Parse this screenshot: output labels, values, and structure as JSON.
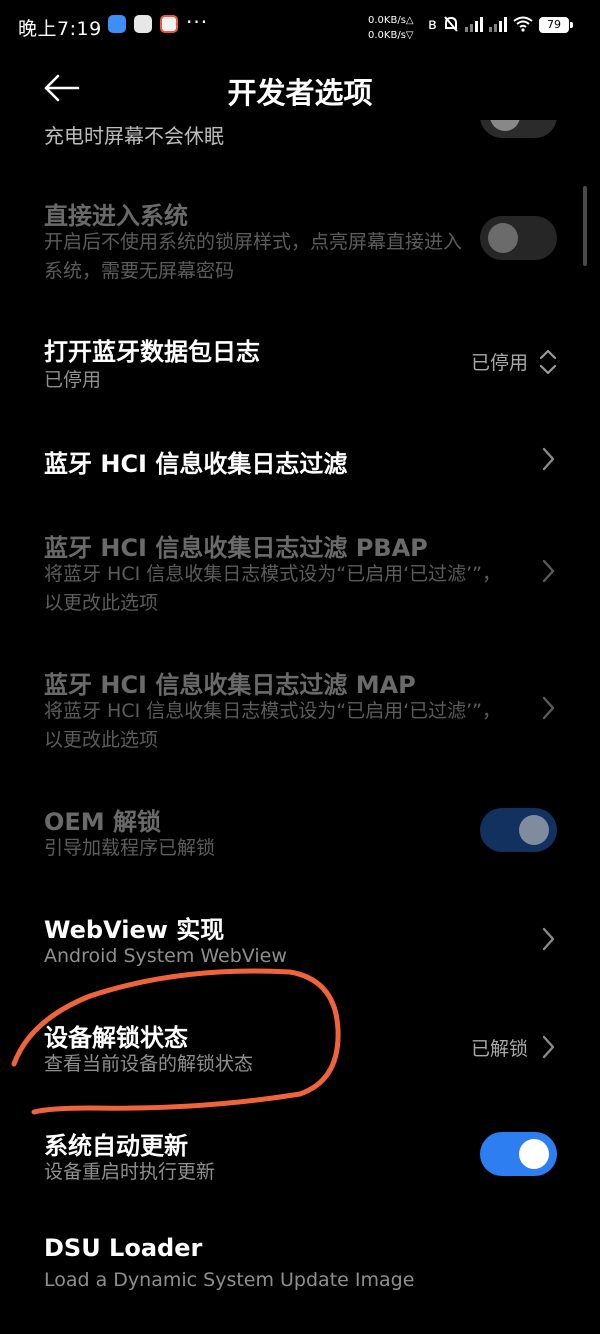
{
  "status_bar": {
    "time": "晚上7:19",
    "more": "···",
    "speed_up": "0.0KB/s△",
    "speed_down": "0.0KB/s▽",
    "battery": "79",
    "icons": [
      "bluetooth-icon",
      "mute-icon",
      "signal-icon",
      "signal-icon",
      "wifi-icon",
      "battery-icon"
    ]
  },
  "header": {
    "title": "开发者选项"
  },
  "rows": [
    {
      "title": "充电时屏幕不会休眠",
      "state": "partially visible, toggle"
    },
    {
      "title": "直接进入系统",
      "subtitle": "开启后不使用系统的锁屏样式，点亮屏幕直接进入系统，需要无屏幕密码",
      "toggle": "off",
      "disabled": true
    },
    {
      "title": "打开蓝牙数据包日志",
      "subtitle": "已停用",
      "value": "已停用"
    },
    {
      "title": "蓝牙 HCI 信息收集日志过滤"
    },
    {
      "title": "蓝牙 HCI 信息收集日志过滤 PBAP",
      "subtitle": "将蓝牙 HCI 信息收集日志模式设为“已启用‘已过滤’”，以更改此选项",
      "disabled": true
    },
    {
      "title": "蓝牙 HCI 信息收集日志过滤 MAP",
      "subtitle": "将蓝牙 HCI 信息收集日志模式设为“已启用‘已过滤’”，以更改此选项",
      "disabled": true
    },
    {
      "title": "OEM 解锁",
      "subtitle": "引导加载程序已解锁",
      "toggle": "on",
      "disabled": true
    },
    {
      "title": "WebView 实现",
      "subtitle": "Android System WebView"
    },
    {
      "title": "设备解锁状态",
      "subtitle": "查看当前设备的解锁状态",
      "value": "已解锁"
    },
    {
      "title": "系统自动更新",
      "subtitle": "设备重启时执行更新",
      "toggle": "on"
    },
    {
      "title": "DSU Loader",
      "subtitle": "Load a Dynamic System Update Image"
    }
  ],
  "colors": {
    "background": "#000000",
    "toggle_on": "#2d7ef0",
    "toggle_on_disabled": "#12315e",
    "toggle_off": "#2b2b2b",
    "annotation": "#f0643c"
  }
}
